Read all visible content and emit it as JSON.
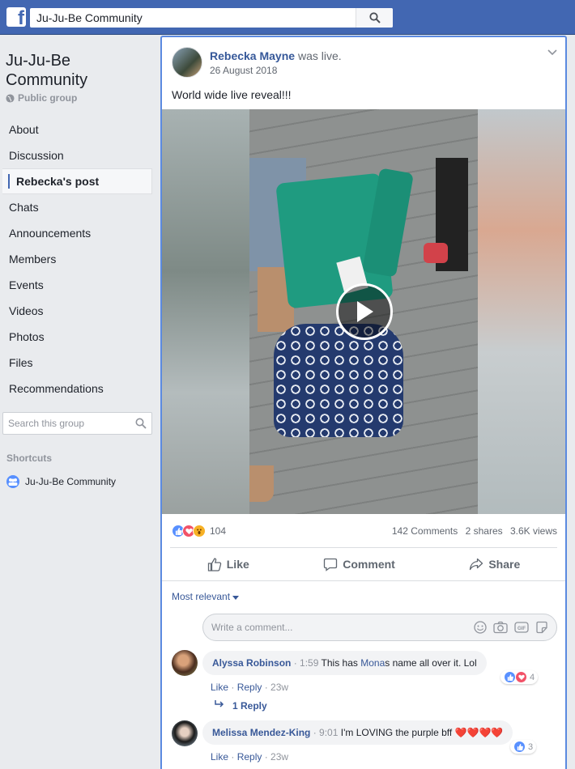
{
  "topbar": {
    "logo": "f",
    "search_value": "Ju-Ju-Be Community"
  },
  "sidebar": {
    "group_name": "Ju-Ju-Be Community",
    "group_type": "Public group",
    "nav": [
      "About",
      "Discussion",
      "Rebecka's post",
      "Chats",
      "Announcements",
      "Members",
      "Events",
      "Videos",
      "Photos",
      "Files",
      "Recommendations"
    ],
    "active_index": 2,
    "search_placeholder": "Search this group",
    "shortcuts_title": "Shortcuts",
    "shortcut_item": "Ju-Ju-Be Community"
  },
  "post": {
    "author": "Rebecka Mayne",
    "action": "was live.",
    "date": "26 August 2018",
    "text": "World wide live reveal!!!",
    "reaction_count": "104",
    "comments_count": "142 Comments",
    "shares_count": "2 shares",
    "views_count": "3.6K views",
    "actions": {
      "like": "Like",
      "comment": "Comment",
      "share": "Share"
    }
  },
  "comments_section": {
    "sort_label": "Most relevant",
    "write_placeholder": "Write a comment...",
    "gif_label": "GIF",
    "items": [
      {
        "name": "Alyssa Robinson",
        "time": "1:59",
        "text_before": "This has ",
        "text_highlight": "Mona",
        "text_after": "s name all over it. Lol",
        "like": "Like",
        "reply": "Reply",
        "age": "23w",
        "reaction_count": "4",
        "replies": "1 Reply"
      },
      {
        "name": "Melissa Mendez-King",
        "time": "9:01",
        "text": "I'm LOVING the purple bff",
        "emoji": "❤️❤️❤️❤️",
        "like": "Like",
        "reply": "Reply",
        "age": "23w",
        "reaction_count": "3"
      }
    ]
  },
  "colors": {
    "brand": "#4267b2",
    "link": "#365899",
    "background": "#e9ebee",
    "like": "#5890ff",
    "love": "#f25268",
    "wow": "#f7b125"
  }
}
